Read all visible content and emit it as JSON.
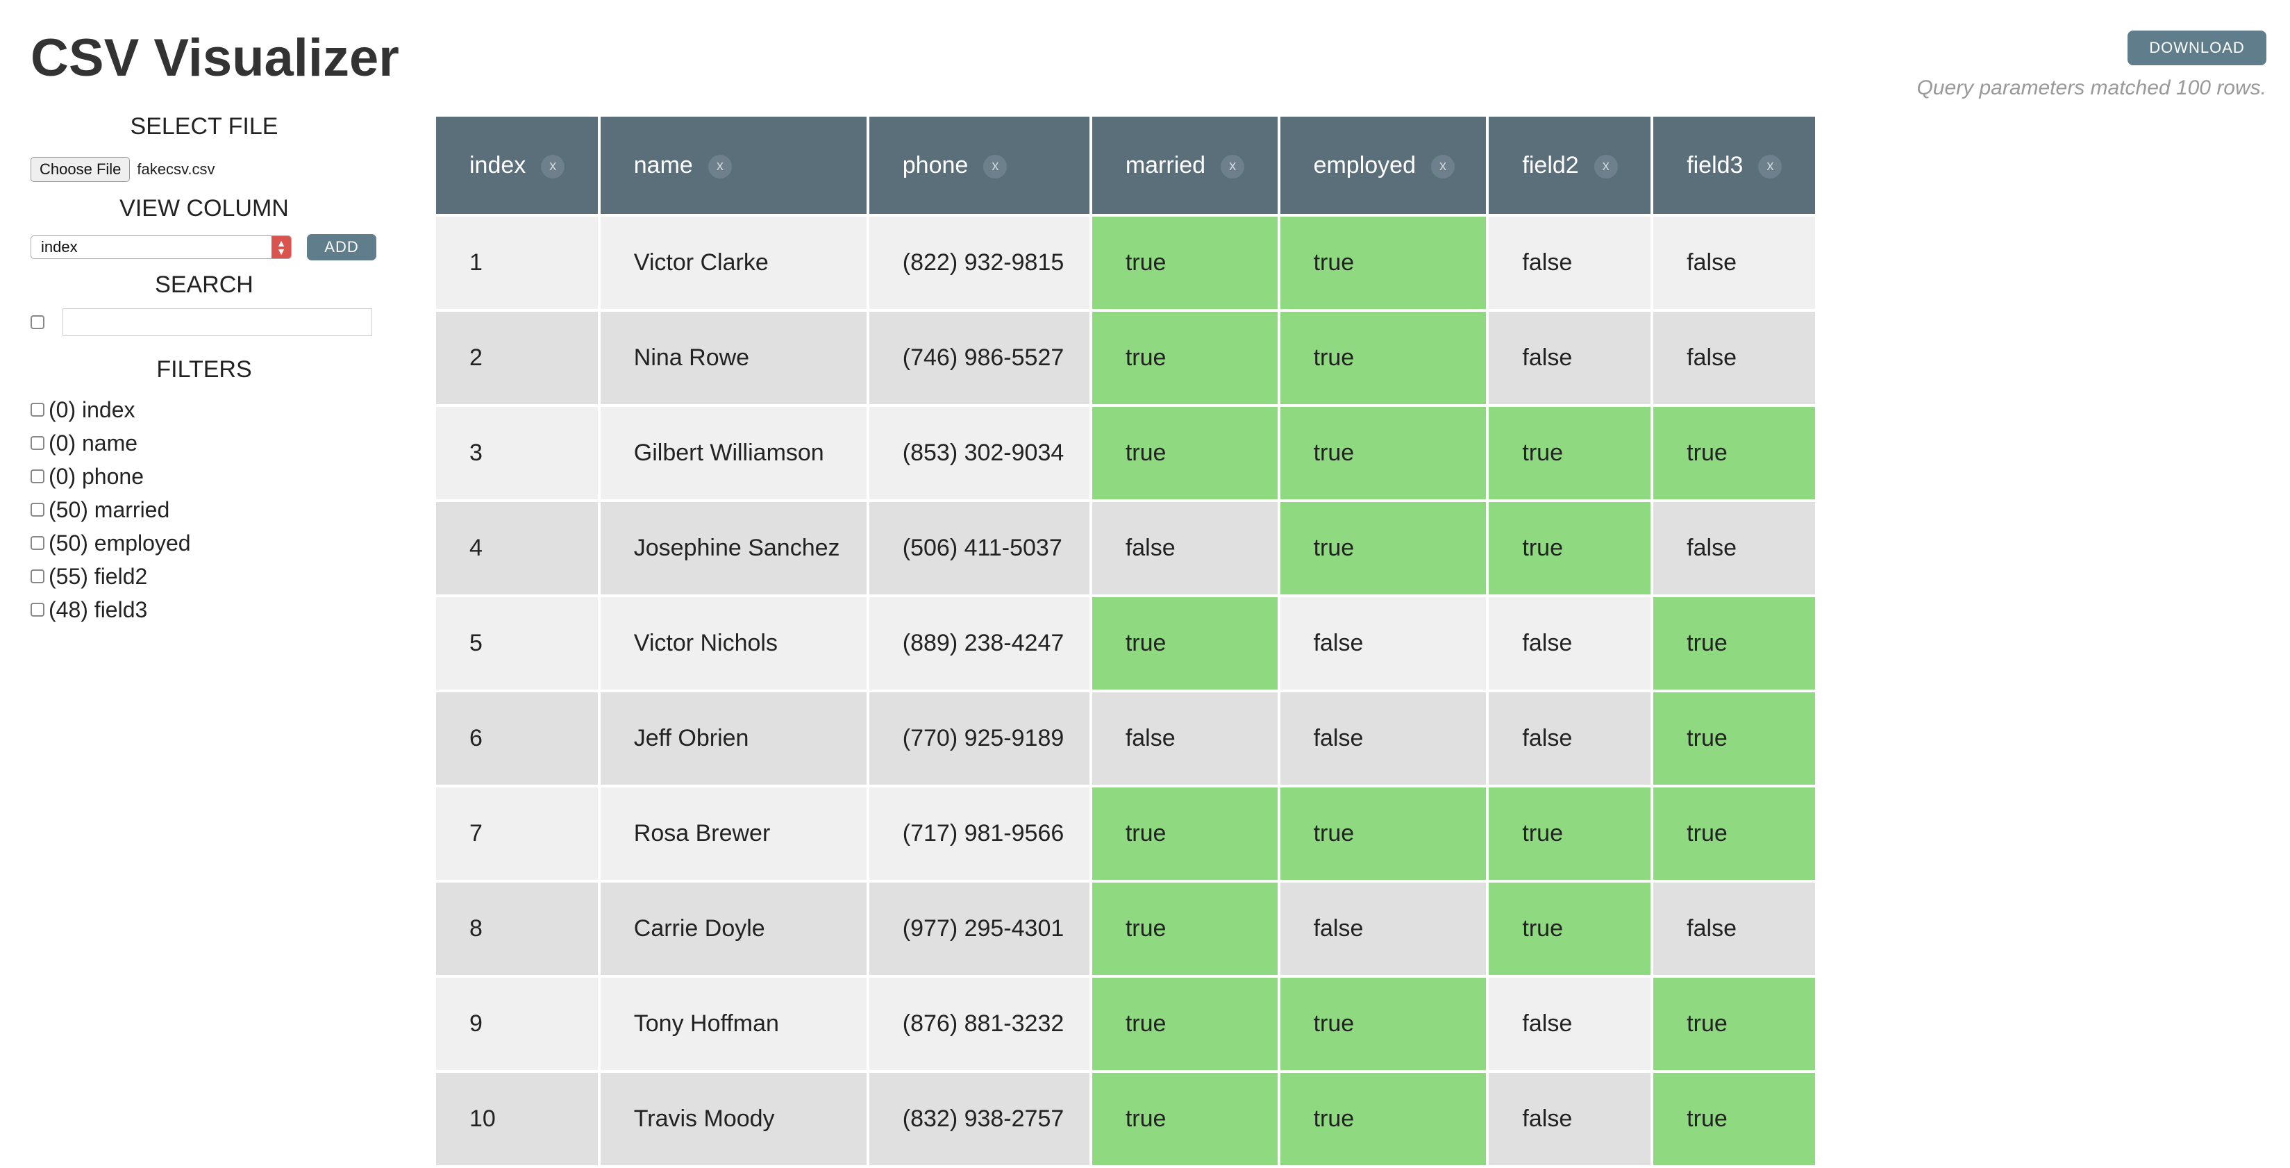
{
  "app": {
    "title": "CSV Visualizer",
    "download_label": "DOWNLOAD",
    "query_status": "Query parameters matched 100 rows."
  },
  "sidebar": {
    "select_file": {
      "title": "SELECT FILE",
      "button_label": "Choose File",
      "file_name": "fakecsv.csv"
    },
    "view_column": {
      "title": "VIEW COLUMN",
      "selected": "index",
      "add_label": "ADD"
    },
    "search": {
      "title": "SEARCH",
      "value": ""
    },
    "filters": {
      "title": "FILTERS",
      "items": [
        {
          "label": "(0) index"
        },
        {
          "label": "(0) name"
        },
        {
          "label": "(0) phone"
        },
        {
          "label": "(50) married"
        },
        {
          "label": "(50) employed"
        },
        {
          "label": "(55) field2"
        },
        {
          "label": "(48) field3"
        }
      ]
    }
  },
  "colors": {
    "header_bg": "#5b6f7b",
    "true_cell": "#8fd981",
    "row_odd": "#f0f0f0",
    "row_even": "#e0e0e0",
    "button_bg": "#607d8b",
    "select_arrow": "#d9534f"
  },
  "table": {
    "close_glyph": "x",
    "columns": [
      "index",
      "name",
      "phone",
      "married",
      "employed",
      "field2",
      "field3"
    ],
    "rows": [
      [
        "1",
        "Victor Clarke",
        "(822) 932-9815",
        "true",
        "true",
        "false",
        "false"
      ],
      [
        "2",
        "Nina Rowe",
        "(746) 986-5527",
        "true",
        "true",
        "false",
        "false"
      ],
      [
        "3",
        "Gilbert Williamson",
        "(853) 302-9034",
        "true",
        "true",
        "true",
        "true"
      ],
      [
        "4",
        "Josephine Sanchez",
        "(506) 411-5037",
        "false",
        "true",
        "true",
        "false"
      ],
      [
        "5",
        "Victor Nichols",
        "(889) 238-4247",
        "true",
        "false",
        "false",
        "true"
      ],
      [
        "6",
        "Jeff Obrien",
        "(770) 925-9189",
        "false",
        "false",
        "false",
        "true"
      ],
      [
        "7",
        "Rosa Brewer",
        "(717) 981-9566",
        "true",
        "true",
        "true",
        "true"
      ],
      [
        "8",
        "Carrie Doyle",
        "(977) 295-4301",
        "true",
        "false",
        "true",
        "false"
      ],
      [
        "9",
        "Tony Hoffman",
        "(876) 881-3232",
        "true",
        "true",
        "false",
        "true"
      ],
      [
        "10",
        "Travis Moody",
        "(832) 938-2757",
        "true",
        "true",
        "false",
        "true"
      ]
    ]
  }
}
